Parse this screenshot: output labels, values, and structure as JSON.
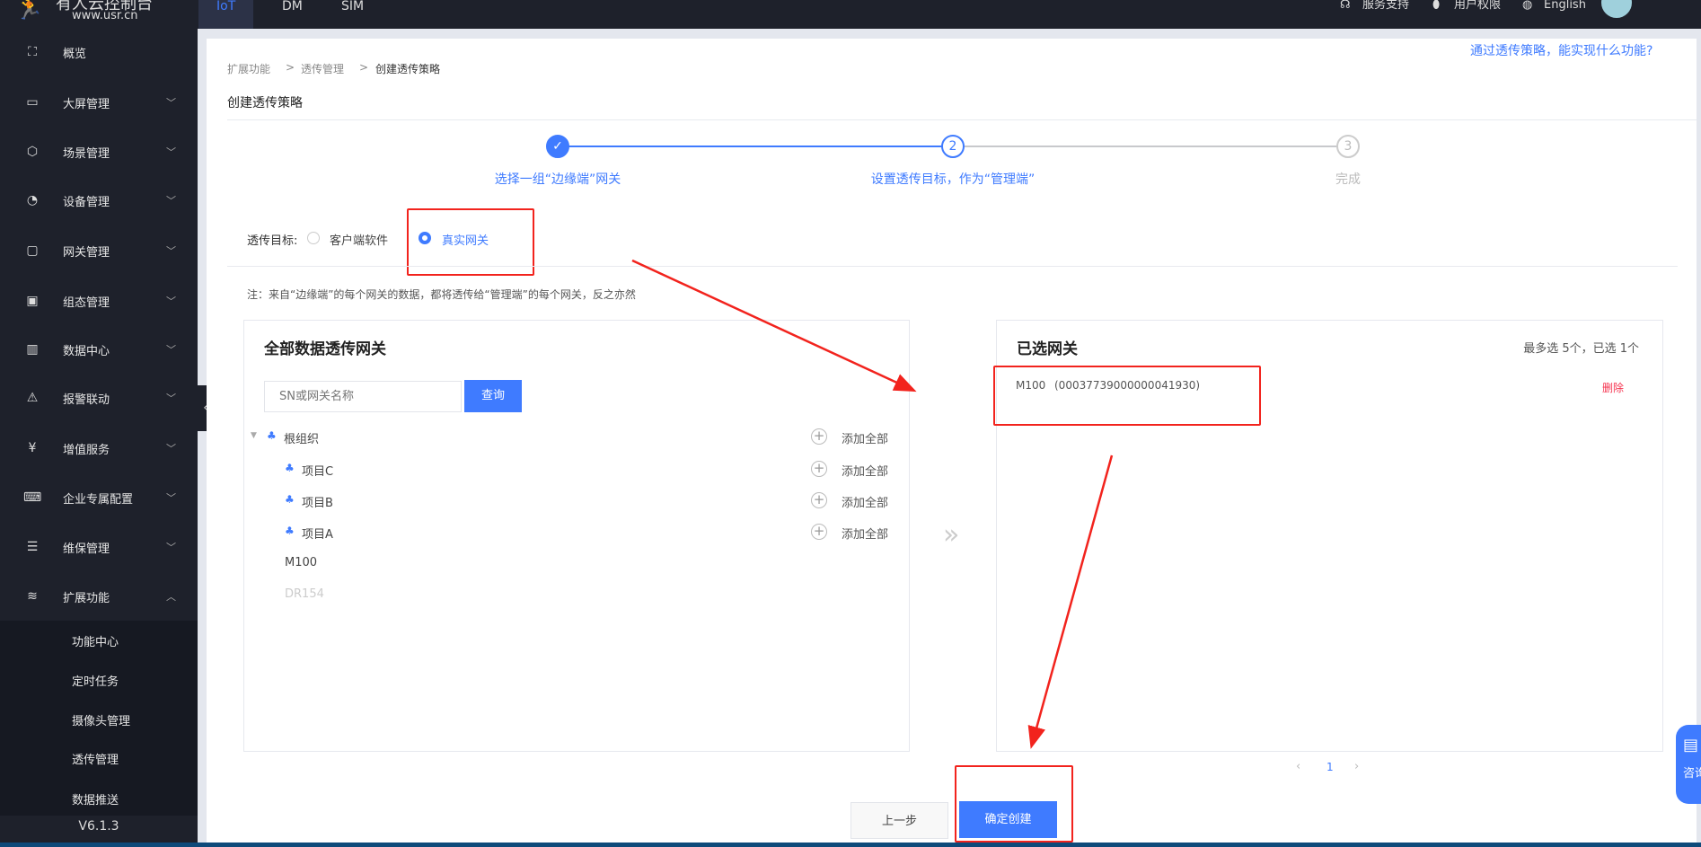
{
  "logo": {
    "title": "有人云控制台",
    "url": "www.usr.cn"
  },
  "topnav": {
    "tabs": [
      {
        "label": "IoT",
        "active": true
      },
      {
        "label": "DM"
      },
      {
        "label": "SIM"
      }
    ],
    "service": "服务支持",
    "permission": "用户权限",
    "language": "English"
  },
  "sidebar": {
    "items": [
      {
        "label": "概览",
        "icon": "overview-icon"
      },
      {
        "label": "大屏管理",
        "icon": "screen-icon"
      },
      {
        "label": "场景管理",
        "icon": "cube-icon"
      },
      {
        "label": "设备管理",
        "icon": "pie-icon"
      },
      {
        "label": "网关管理",
        "icon": "gateway-icon"
      },
      {
        "label": "组态管理",
        "icon": "image-icon"
      },
      {
        "label": "数据中心",
        "icon": "bar-chart-icon"
      },
      {
        "label": "报警联动",
        "icon": "alarm-icon"
      },
      {
        "label": "增值服务",
        "icon": "yen-icon"
      },
      {
        "label": "企业专属配置",
        "icon": "code-icon"
      },
      {
        "label": "维保管理",
        "icon": "list-icon"
      },
      {
        "label": "扩展功能",
        "icon": "layers-icon"
      }
    ],
    "submenu": [
      "功能中心",
      "定时任务",
      "摄像头管理",
      "透传管理",
      "数据推送"
    ],
    "version": "V6.1.3"
  },
  "breadcrumb": [
    "扩展功能",
    "透传管理",
    "创建透传策略"
  ],
  "page_title": "创建透传策略",
  "help_link": "通过透传策略，能实现什么功能?",
  "steps": [
    {
      "num": "✓",
      "label": "选择一组“边缘端”网关",
      "state": "done"
    },
    {
      "num": "2",
      "label": "设置透传目标，作为“管理端”",
      "state": "active"
    },
    {
      "num": "3",
      "label": "完成",
      "state": "pending"
    }
  ],
  "target": {
    "label": "透传目标:",
    "options": [
      "客户端软件",
      "真实网关"
    ],
    "selected": "真实网关"
  },
  "note": "注：来自“边缘端”的每个网关的数据，都将透传给“管理端”的每个网关，反之亦然",
  "left_panel": {
    "title": "全部数据透传网关",
    "search_placeholder": "SN或网关名称",
    "search_button": "查询",
    "add_all": "添加全部",
    "tree": [
      {
        "label": "根组织",
        "type": "org"
      },
      {
        "label": "项目C",
        "type": "org"
      },
      {
        "label": "项目B",
        "type": "org"
      },
      {
        "label": "项目A",
        "type": "org"
      },
      {
        "label": "M100",
        "type": "gateway"
      },
      {
        "label": "DR154",
        "type": "gateway-disabled"
      }
    ]
  },
  "right_panel": {
    "title": "已选网关",
    "counter": "最多选 5个，已选 1个",
    "items": [
      {
        "name": "M100",
        "sn": "(00037739000000041930)",
        "action": "删除"
      }
    ],
    "page": "1"
  },
  "buttons": {
    "prev": "上一步",
    "create": "确定创建"
  },
  "consult": "咨询",
  "colors": {
    "primary": "#3f7bff",
    "sidebar": "#1e212b",
    "danger": "#f5334f",
    "annotation": "#f2231d"
  }
}
